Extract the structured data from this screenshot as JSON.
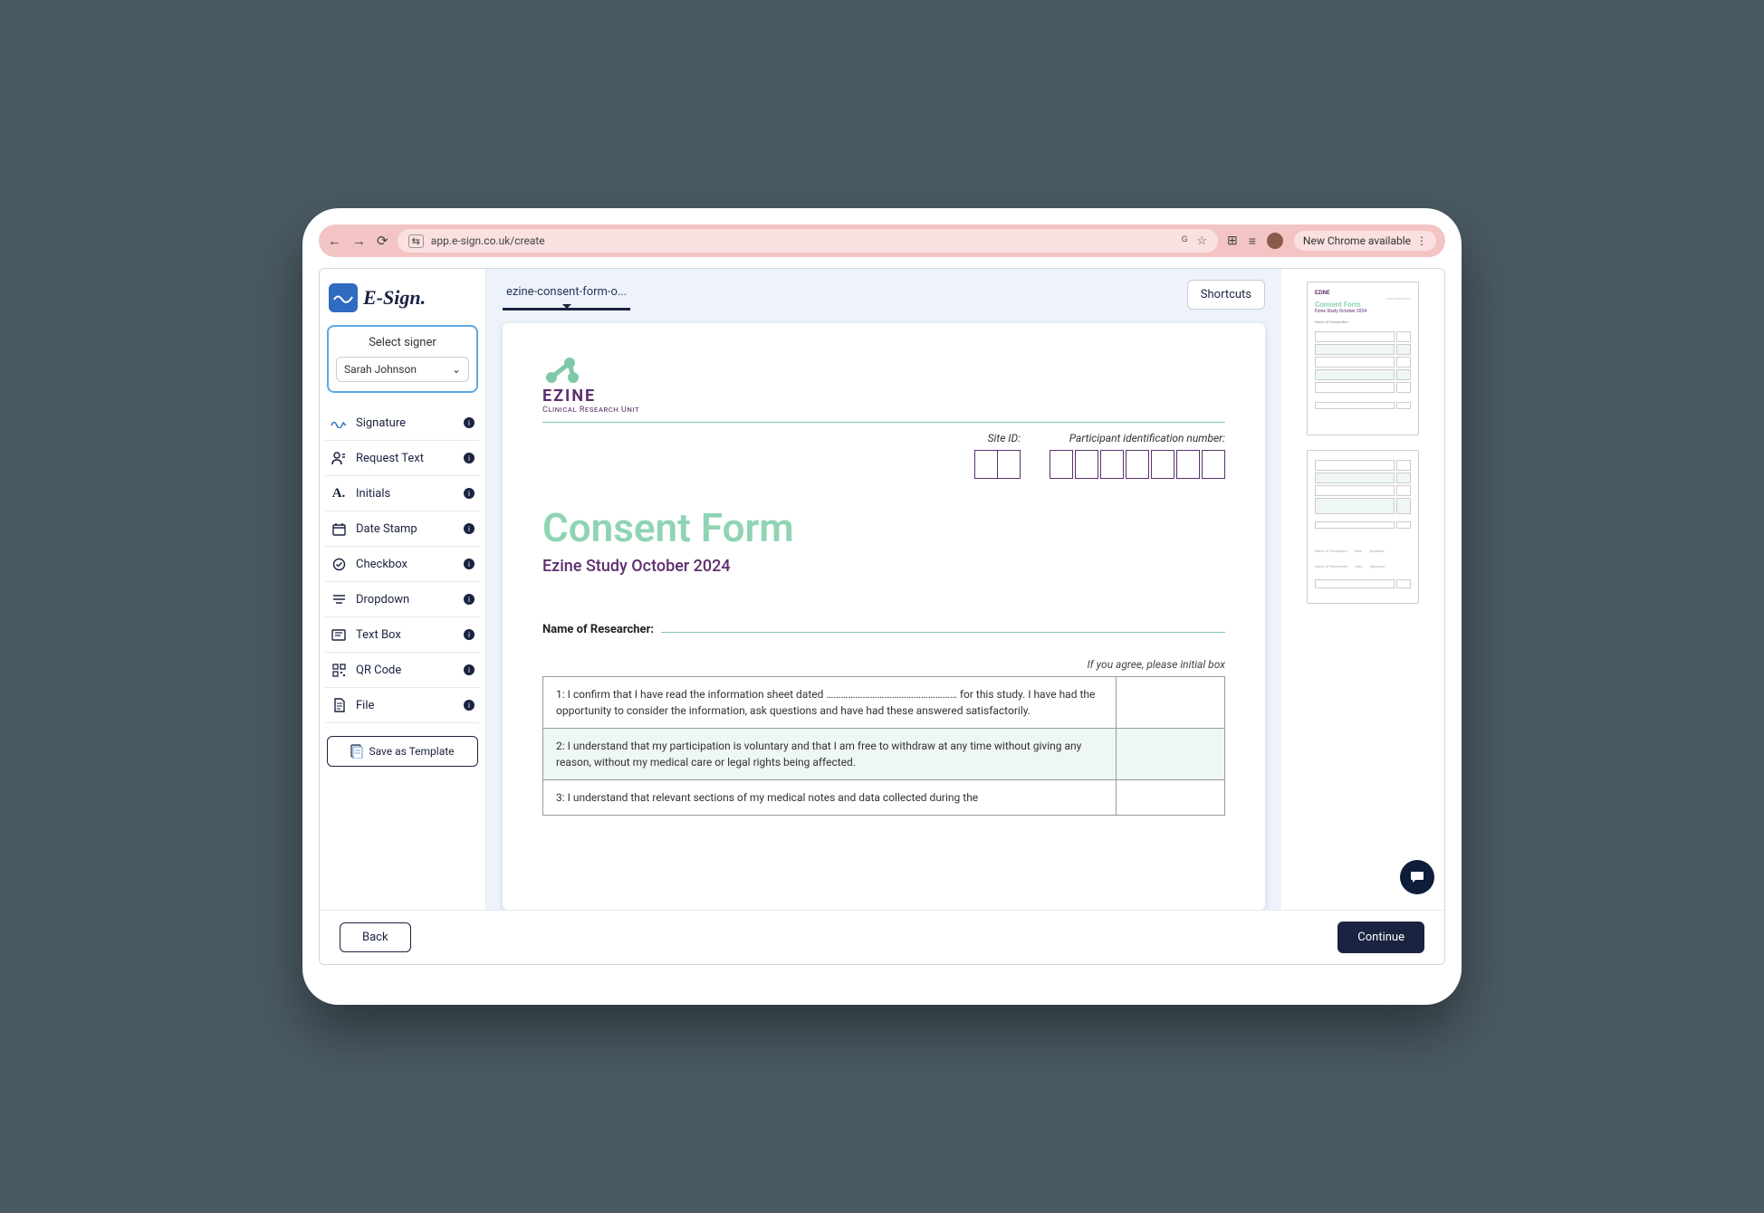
{
  "browser": {
    "url": "app.e-sign.co.uk/create",
    "update_pill": "New Chrome available"
  },
  "brand": {
    "name": "E-Sign."
  },
  "signer": {
    "panel_label": "Select signer",
    "selected": "Sarah Johnson"
  },
  "tools": [
    {
      "label": "Signature"
    },
    {
      "label": "Request Text"
    },
    {
      "label": "Initials"
    },
    {
      "label": "Date Stamp"
    },
    {
      "label": "Checkbox"
    },
    {
      "label": "Dropdown"
    },
    {
      "label": "Text Box"
    },
    {
      "label": "QR Code"
    },
    {
      "label": "File"
    }
  ],
  "save_template_label": "Save as Template",
  "doc_tab": "ezine-consent-form-o...",
  "shortcuts_label": "Shortcuts",
  "footer": {
    "back": "Back",
    "continue": "Continue"
  },
  "document": {
    "logo_name": "EZINE",
    "logo_sub": "Clinical Research Unit",
    "site_id_label": "Site ID:",
    "participant_label": "Participant identification number:",
    "title": "Consent Form",
    "subtitle": "Ezine Study October 2024",
    "researcher_label": "Name of Researcher:",
    "agree_hint": "If you agree, please initial box",
    "items": [
      "1:   I confirm that I have read the information sheet dated ……………………………………………… for this study. I have had the opportunity to consider the information, ask questions and have had these answered satisfactorily.",
      "2:   I understand that my participation is voluntary and that I am free to withdraw at any time without giving any reason, without my medical care or legal rights being affected.",
      "3:   I understand that relevant sections of my medical notes and data collected during the"
    ]
  },
  "colors": {
    "brand_navy": "#1a2340",
    "accent_green": "#8fd4b3",
    "doc_purple": "#5d2f6e"
  }
}
